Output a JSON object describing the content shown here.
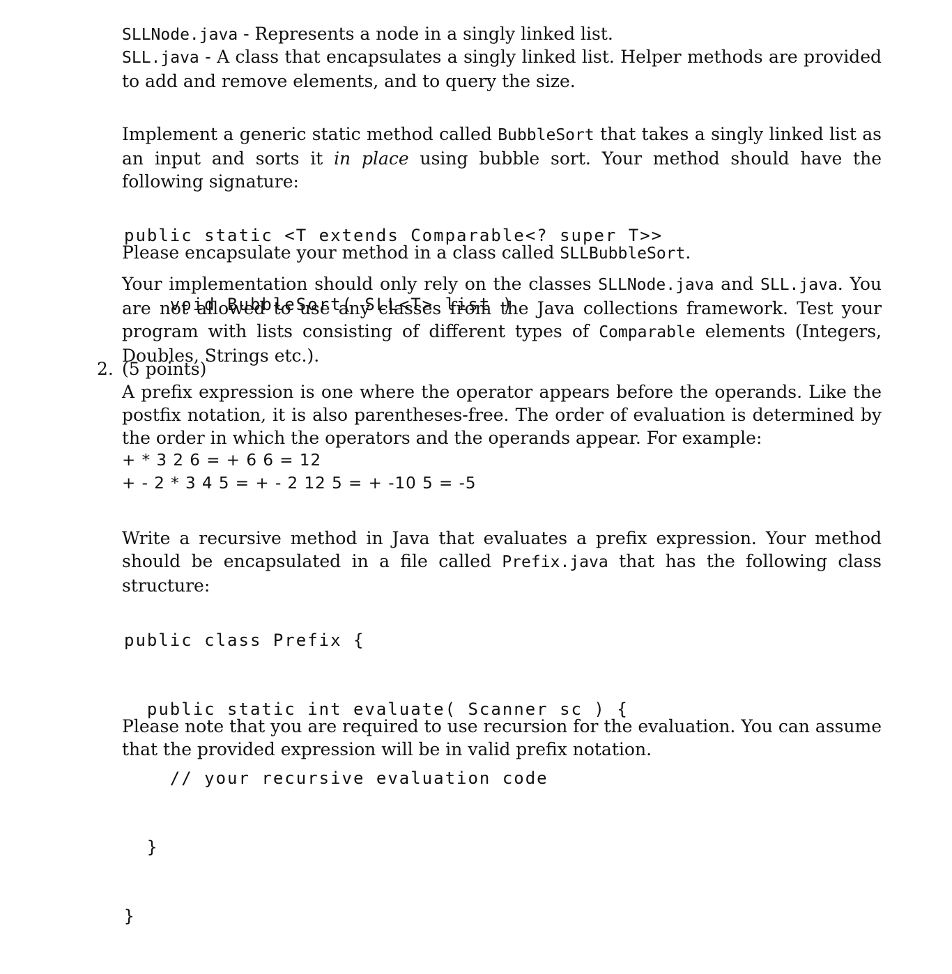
{
  "section1": {
    "sllnode": {
      "code": "SLLNode.java",
      "text": " - Represents a node in a singly linked list."
    },
    "sll": {
      "code": "SLL.java",
      "text": " - A class that encapsulates a singly linked list. Helper methods are provided to add and remove elements, and to query the size."
    },
    "implement": {
      "p1": "Implement a generic static method called ",
      "method_name": "BubbleSort",
      "p2": " that takes a singly linked list as an input and sorts it ",
      "emph": "in place",
      "p3": " using bubble sort. Your method should have the following signature:"
    },
    "signature": {
      "line1": "public static <T extends Comparable<? super T>>",
      "line2": "    void BubbleSort( SLL<T> list )"
    },
    "encapsulate": {
      "p1": "Please encapsulate your method in a class called ",
      "class_name": "SLLBubbleSort",
      "p2": "."
    },
    "rely": {
      "p1": "Your implementation should only rely on the classes ",
      "c1": "SLLNode.java",
      "p2": " and ",
      "c2": "SLL.java",
      "p3": ". You are not allowed to use any classes from the Java collections framework. Test your program with lists consisting of different types of ",
      "c3": "Comparable",
      "p4": " elements (Integers, Doubles, Strings etc.)."
    }
  },
  "section2": {
    "number": "2.",
    "points": "(5 points)",
    "intro": "A prefix expression is one where the operator appears before the operands. Like the postfix notation, it is also parentheses-free. The order of evaluation is determined by the order in which the operators and the operands appear. For example:",
    "examples": [
      "+ * 3 2 6 = + 6 6 = 12",
      "+ - 2 * 3 4 5 = + - 2 12 5 = + -10 5 = -5"
    ],
    "write": {
      "p1": "Write a recursive method in Java that evaluates a prefix expression. Your method should be encapsulated in a file called ",
      "file": "Prefix.java",
      "p2": " that has the following class structure:"
    },
    "code_lines": [
      "public class Prefix {",
      "  public static int evaluate( Scanner sc ) {",
      "    // your recursive evaluation code",
      "  }",
      "}"
    ],
    "note": "Please note that you are required to use recursion for the evaluation. You can assume that the provided expression will be in valid prefix notation."
  }
}
